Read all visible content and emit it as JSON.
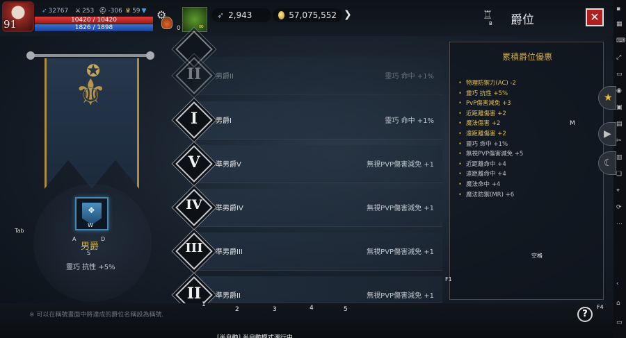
{
  "player": {
    "level": "91",
    "hp": "10420 / 10420",
    "mp": "1826 / 1898",
    "stats": [
      {
        "icon": "wing-icon",
        "value": "32767"
      },
      {
        "icon": "sword-icon",
        "value": "253"
      },
      {
        "icon": "helmet-icon",
        "value": "-306"
      },
      {
        "icon": "trophy-icon",
        "value": "59"
      }
    ],
    "potion_count": "0"
  },
  "currency": {
    "feather": "2,943",
    "gold": "57,075,552"
  },
  "window": {
    "title": "爵位",
    "close_label": "✕",
    "title_key": "B"
  },
  "ranks": [
    {
      "numeral": "II",
      "name": "男爵II",
      "effect": "靈巧 命中 +1%",
      "state": "dim"
    },
    {
      "numeral": "I",
      "name": "男爵I",
      "effect": "靈巧 命中 +1%",
      "state": "normal"
    },
    {
      "numeral": "V",
      "name": "準男爵V",
      "effect": "無視PVP傷害減免 +1",
      "state": "normal"
    },
    {
      "numeral": "IV",
      "name": "準男爵IV",
      "effect": "無視PVP傷害減免 +1",
      "state": "normal"
    },
    {
      "numeral": "III",
      "name": "準男爵III",
      "effect": "無視PVP傷害減免 +1",
      "state": "normal"
    },
    {
      "numeral": "II",
      "name": "準男爵II",
      "effect": "無視PVP傷害減免 +1",
      "state": "normal"
    }
  ],
  "current": {
    "name": "男爵",
    "effect": "靈巧 抗性 +5%",
    "keys": {
      "a": "A",
      "d": "D",
      "s": "S",
      "w": "W"
    }
  },
  "bonus": {
    "title": "累積爵位優惠",
    "items": [
      {
        "text": "物理防禦力(AC) -2",
        "gold": true
      },
      {
        "text": "靈巧 抗性 +5%",
        "gold": true
      },
      {
        "text": "PvP傷害減免 +3",
        "gold": true
      },
      {
        "text": "近距離傷害 +2",
        "gold": true
      },
      {
        "text": "魔法傷害 +2",
        "gold": true
      },
      {
        "text": "遠距離傷害 +2",
        "gold": true
      },
      {
        "text": "靈巧 命中 +1%",
        "gold": false
      },
      {
        "text": "無視PVP傷害減免 +5",
        "gold": false
      },
      {
        "text": "近距離命中 +4",
        "gold": false
      },
      {
        "text": "遠距離命中 +4",
        "gold": false
      },
      {
        "text": "魔法命中 +4",
        "gold": false
      },
      {
        "text": "魔法防禦(MR) +6",
        "gold": false
      }
    ],
    "space_label": "空格",
    "m_key": "M"
  },
  "footer": {
    "hint": "※ 可以在稱號畫面中將達成的爵位名稱設為稱號.",
    "help": "?",
    "auto_text": "[半自動] 半自動模式運行中",
    "hotkeys": [
      "1",
      "2",
      "3",
      "4",
      "5"
    ],
    "f1": "F1",
    "f4": "F4",
    "tab": "Tab"
  },
  "colors": {
    "accent_gold": "#d9b24a",
    "close_red": "#b12020"
  }
}
